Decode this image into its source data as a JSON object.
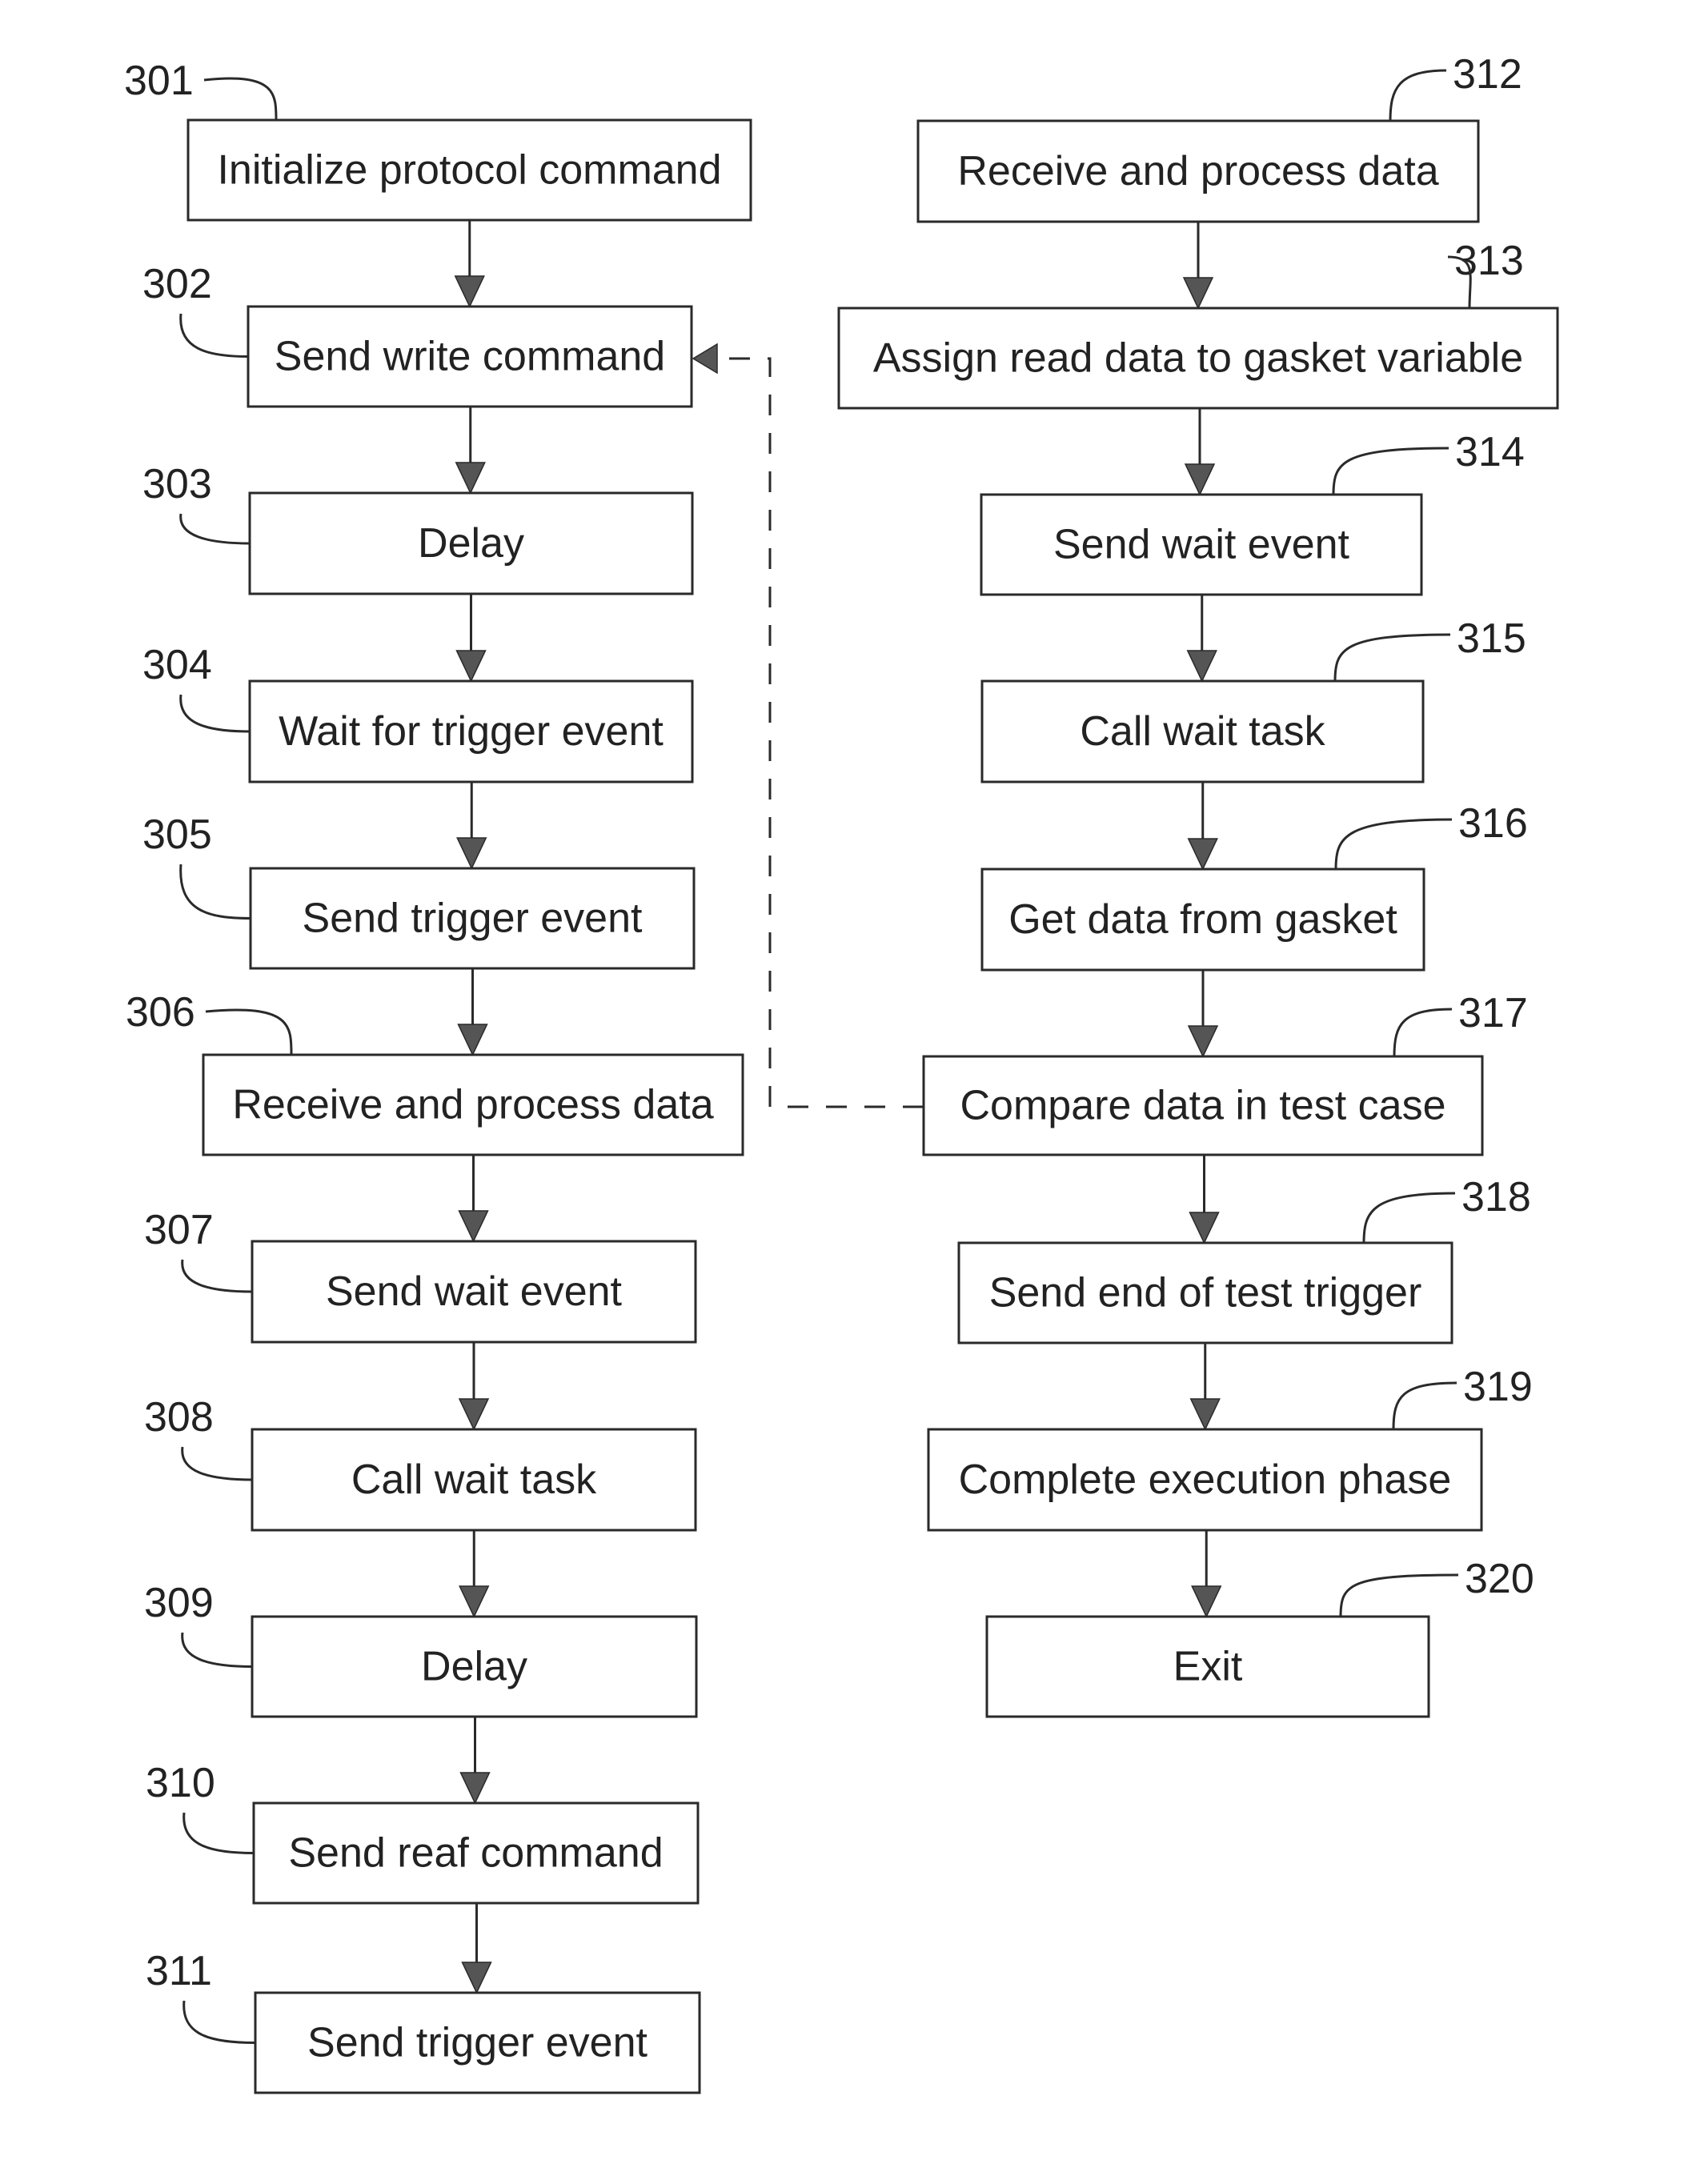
{
  "figure": {
    "left_column": [
      {
        "ref": "301",
        "label": "Initialize protocol command"
      },
      {
        "ref": "302",
        "label": "Send write command"
      },
      {
        "ref": "303",
        "label": "Delay"
      },
      {
        "ref": "304",
        "label": "Wait for trigger event"
      },
      {
        "ref": "305",
        "label": "Send trigger event"
      },
      {
        "ref": "306",
        "label": "Receive and process data"
      },
      {
        "ref": "307",
        "label": "Send wait event"
      },
      {
        "ref": "308",
        "label": "Call wait task"
      },
      {
        "ref": "309",
        "label": "Delay"
      },
      {
        "ref": "310",
        "label": "Send reaf command"
      },
      {
        "ref": "311",
        "label": "Send trigger event"
      }
    ],
    "right_column": [
      {
        "ref": "312",
        "label": "Receive and process data"
      },
      {
        "ref": "313",
        "label": "Assign read data to gasket variable"
      },
      {
        "ref": "314",
        "label": "Send wait event"
      },
      {
        "ref": "315",
        "label": "Call wait task"
      },
      {
        "ref": "316",
        "label": "Get data from gasket"
      },
      {
        "ref": "317",
        "label": "Compare data in test case"
      },
      {
        "ref": "318",
        "label": "Send end of test trigger"
      },
      {
        "ref": "319",
        "label": "Complete execution phase"
      },
      {
        "ref": "320",
        "label": "Exit"
      }
    ],
    "feedback_edge": {
      "from": "317",
      "to": "302",
      "style": "dashed"
    }
  }
}
